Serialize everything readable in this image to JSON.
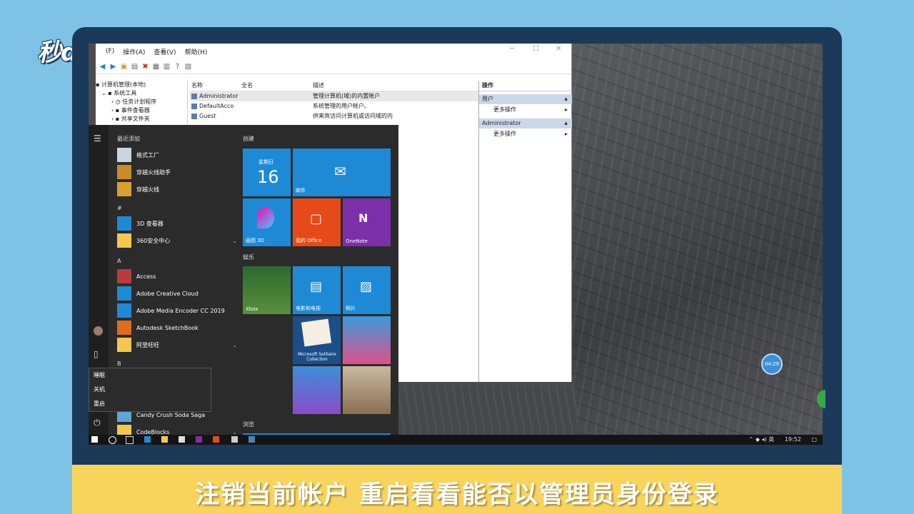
{
  "brand": {
    "logo_text": "秒dong视频"
  },
  "subtitle": "注销当前帐户 重启看看能否以管理员身份登录",
  "mmc": {
    "menu": [
      "(F)",
      "操作(A)",
      "查看(V)",
      "帮助(H)"
    ],
    "tree": [
      "计算机管理(本地)",
      "系统工具",
      "任务计划程序",
      "事件查看器",
      "共享文件夹"
    ],
    "columns": [
      "名称",
      "全名",
      "描述"
    ],
    "rows": [
      {
        "name": "Administrator",
        "full": "",
        "desc": "管理计算机(域)的内置帐户"
      },
      {
        "name": "DefaultAcco",
        "full": "",
        "desc": "系统管理的用户帐户。"
      },
      {
        "name": "Guest",
        "full": "",
        "desc": "供来宾访问计算机或访问域的内"
      }
    ],
    "actions": {
      "header": "操作",
      "group1": "用户",
      "item1": "更多操作",
      "group2": "Administrator",
      "item2": "更多操作"
    }
  },
  "start_menu": {
    "recent_header": "最近添加",
    "recent": [
      "格式工厂",
      "穿越火线助手",
      "穿越火线"
    ],
    "section_hash": "#",
    "hash_apps": [
      "3D 查看器",
      "360安全中心"
    ],
    "section_a": "A",
    "a_apps": [
      "Access",
      "Adobe Creative Cloud",
      "Adobe Media Encoder CC 2019",
      "Autodesk SketchBook",
      "阿里旺旺"
    ],
    "section_b": "B",
    "c_apps": [
      "Candy Crush Soda Saga",
      "CodeBlocks"
    ],
    "power_menu": [
      "睡眠",
      "关机",
      "重启"
    ],
    "tiles": {
      "group_create": "创建",
      "calendar_day": "星期日",
      "calendar_date": "16",
      "mail": "邮件",
      "paint3d": "画图 3D",
      "office": "我的 Office",
      "onenote": "OneNote",
      "group_play": "娱乐",
      "xbox": "Xbox",
      "movies": "电影和电视",
      "photos": "照片",
      "solitaire": "Microsoft Solitaire Collection",
      "group_browse": "浏览"
    }
  },
  "taskbar": {
    "lang": "英",
    "time": "19:52"
  },
  "bubble_time": "04:29"
}
